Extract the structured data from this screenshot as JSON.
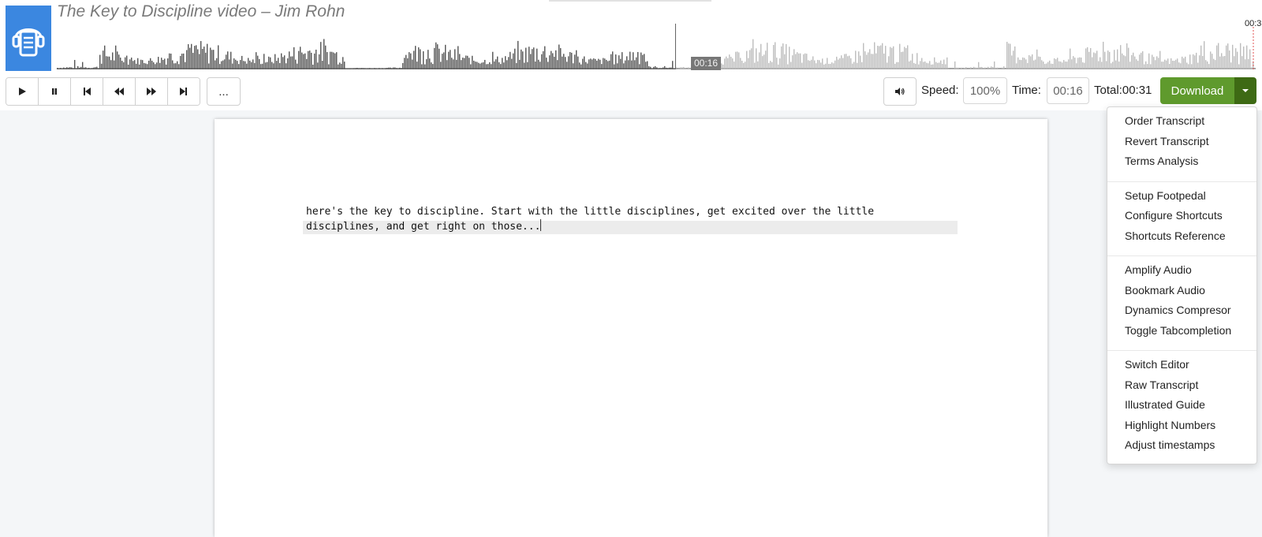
{
  "header": {
    "title": "The Key to Discipline video – Jim Rohn",
    "logo_icon": "headphones-transcript-icon",
    "wave_end_label": "00:3",
    "current_position_badge": "00:16",
    "progress_fraction": 0.516
  },
  "colors": {
    "logo_bg": "#3b87e0",
    "download_bg": "#5f9a2d",
    "download_caret_bg": "#3e6a14",
    "wave_played": "#555555",
    "wave_unplayed": "#bdbdbd"
  },
  "transport": {
    "buttons": [
      {
        "name": "play-button",
        "icon": "play-icon"
      },
      {
        "name": "pause-button",
        "icon": "pause-icon"
      },
      {
        "name": "skip-back-button",
        "icon": "skip-back-icon"
      },
      {
        "name": "rewind-button",
        "icon": "rewind-icon"
      },
      {
        "name": "fast-forward-button",
        "icon": "fast-forward-icon"
      },
      {
        "name": "skip-forward-button",
        "icon": "skip-forward-icon"
      }
    ],
    "more_label": "...",
    "volume_icon": "speaker-icon"
  },
  "playback": {
    "speed_label": "Speed:",
    "speed_value": "100%",
    "time_label": "Time:",
    "time_value": "00:16",
    "total_label": "Total:00:31",
    "download_label": "Download"
  },
  "document": {
    "line1": "here's the key to discipline. Start with the little disciplines, get excited over the little",
    "line2": "disciplines, and get right on those..."
  },
  "download_menu": {
    "groups": [
      [
        "Order Transcript",
        "Revert Transcript",
        "Terms Analysis"
      ],
      [
        "Setup Footpedal",
        "Configure Shortcuts",
        "Shortcuts Reference"
      ],
      [
        "Amplify Audio",
        "Bookmark Audio",
        "Dynamics Compresor",
        "Toggle Tabcompletion"
      ],
      [
        "Switch Editor",
        "Raw Transcript",
        "Illustrated Guide",
        "Highlight Numbers",
        "Adjust timestamps"
      ]
    ]
  }
}
